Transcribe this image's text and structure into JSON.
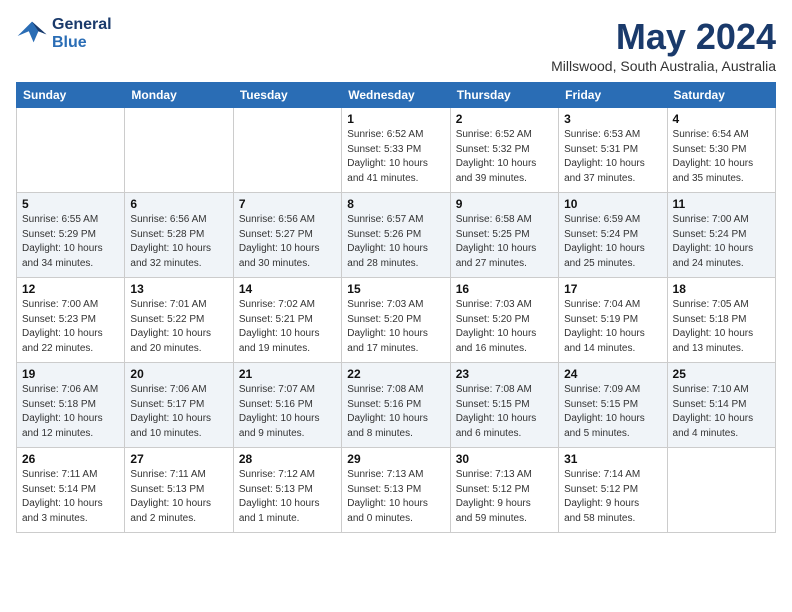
{
  "header": {
    "logo_line1": "General",
    "logo_line2": "Blue",
    "month": "May 2024",
    "location": "Millswood, South Australia, Australia"
  },
  "weekdays": [
    "Sunday",
    "Monday",
    "Tuesday",
    "Wednesday",
    "Thursday",
    "Friday",
    "Saturday"
  ],
  "weeks": [
    [
      {
        "day": "",
        "info": ""
      },
      {
        "day": "",
        "info": ""
      },
      {
        "day": "",
        "info": ""
      },
      {
        "day": "1",
        "info": "Sunrise: 6:52 AM\nSunset: 5:33 PM\nDaylight: 10 hours\nand 41 minutes."
      },
      {
        "day": "2",
        "info": "Sunrise: 6:52 AM\nSunset: 5:32 PM\nDaylight: 10 hours\nand 39 minutes."
      },
      {
        "day": "3",
        "info": "Sunrise: 6:53 AM\nSunset: 5:31 PM\nDaylight: 10 hours\nand 37 minutes."
      },
      {
        "day": "4",
        "info": "Sunrise: 6:54 AM\nSunset: 5:30 PM\nDaylight: 10 hours\nand 35 minutes."
      }
    ],
    [
      {
        "day": "5",
        "info": "Sunrise: 6:55 AM\nSunset: 5:29 PM\nDaylight: 10 hours\nand 34 minutes."
      },
      {
        "day": "6",
        "info": "Sunrise: 6:56 AM\nSunset: 5:28 PM\nDaylight: 10 hours\nand 32 minutes."
      },
      {
        "day": "7",
        "info": "Sunrise: 6:56 AM\nSunset: 5:27 PM\nDaylight: 10 hours\nand 30 minutes."
      },
      {
        "day": "8",
        "info": "Sunrise: 6:57 AM\nSunset: 5:26 PM\nDaylight: 10 hours\nand 28 minutes."
      },
      {
        "day": "9",
        "info": "Sunrise: 6:58 AM\nSunset: 5:25 PM\nDaylight: 10 hours\nand 27 minutes."
      },
      {
        "day": "10",
        "info": "Sunrise: 6:59 AM\nSunset: 5:24 PM\nDaylight: 10 hours\nand 25 minutes."
      },
      {
        "day": "11",
        "info": "Sunrise: 7:00 AM\nSunset: 5:24 PM\nDaylight: 10 hours\nand 24 minutes."
      }
    ],
    [
      {
        "day": "12",
        "info": "Sunrise: 7:00 AM\nSunset: 5:23 PM\nDaylight: 10 hours\nand 22 minutes."
      },
      {
        "day": "13",
        "info": "Sunrise: 7:01 AM\nSunset: 5:22 PM\nDaylight: 10 hours\nand 20 minutes."
      },
      {
        "day": "14",
        "info": "Sunrise: 7:02 AM\nSunset: 5:21 PM\nDaylight: 10 hours\nand 19 minutes."
      },
      {
        "day": "15",
        "info": "Sunrise: 7:03 AM\nSunset: 5:20 PM\nDaylight: 10 hours\nand 17 minutes."
      },
      {
        "day": "16",
        "info": "Sunrise: 7:03 AM\nSunset: 5:20 PM\nDaylight: 10 hours\nand 16 minutes."
      },
      {
        "day": "17",
        "info": "Sunrise: 7:04 AM\nSunset: 5:19 PM\nDaylight: 10 hours\nand 14 minutes."
      },
      {
        "day": "18",
        "info": "Sunrise: 7:05 AM\nSunset: 5:18 PM\nDaylight: 10 hours\nand 13 minutes."
      }
    ],
    [
      {
        "day": "19",
        "info": "Sunrise: 7:06 AM\nSunset: 5:18 PM\nDaylight: 10 hours\nand 12 minutes."
      },
      {
        "day": "20",
        "info": "Sunrise: 7:06 AM\nSunset: 5:17 PM\nDaylight: 10 hours\nand 10 minutes."
      },
      {
        "day": "21",
        "info": "Sunrise: 7:07 AM\nSunset: 5:16 PM\nDaylight: 10 hours\nand 9 minutes."
      },
      {
        "day": "22",
        "info": "Sunrise: 7:08 AM\nSunset: 5:16 PM\nDaylight: 10 hours\nand 8 minutes."
      },
      {
        "day": "23",
        "info": "Sunrise: 7:08 AM\nSunset: 5:15 PM\nDaylight: 10 hours\nand 6 minutes."
      },
      {
        "day": "24",
        "info": "Sunrise: 7:09 AM\nSunset: 5:15 PM\nDaylight: 10 hours\nand 5 minutes."
      },
      {
        "day": "25",
        "info": "Sunrise: 7:10 AM\nSunset: 5:14 PM\nDaylight: 10 hours\nand 4 minutes."
      }
    ],
    [
      {
        "day": "26",
        "info": "Sunrise: 7:11 AM\nSunset: 5:14 PM\nDaylight: 10 hours\nand 3 minutes."
      },
      {
        "day": "27",
        "info": "Sunrise: 7:11 AM\nSunset: 5:13 PM\nDaylight: 10 hours\nand 2 minutes."
      },
      {
        "day": "28",
        "info": "Sunrise: 7:12 AM\nSunset: 5:13 PM\nDaylight: 10 hours\nand 1 minute."
      },
      {
        "day": "29",
        "info": "Sunrise: 7:13 AM\nSunset: 5:13 PM\nDaylight: 10 hours\nand 0 minutes."
      },
      {
        "day": "30",
        "info": "Sunrise: 7:13 AM\nSunset: 5:12 PM\nDaylight: 9 hours\nand 59 minutes."
      },
      {
        "day": "31",
        "info": "Sunrise: 7:14 AM\nSunset: 5:12 PM\nDaylight: 9 hours\nand 58 minutes."
      },
      {
        "day": "",
        "info": ""
      }
    ]
  ]
}
